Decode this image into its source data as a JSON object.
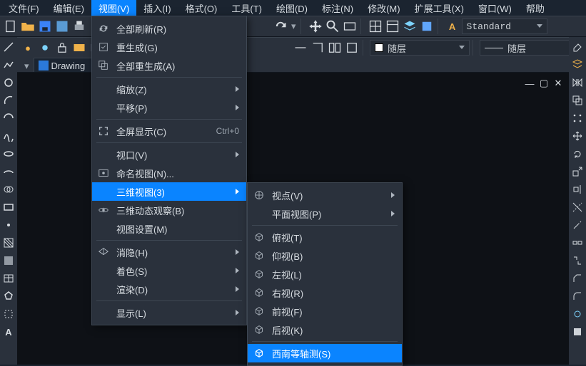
{
  "menubar": [
    "文件(F)",
    "编辑(E)",
    "视图(V)",
    "插入(I)",
    "格式(O)",
    "工具(T)",
    "绘图(D)",
    "标注(N)",
    "修改(M)",
    "扩展工具(X)",
    "窗口(W)",
    "帮助"
  ],
  "menubar_active_index": 2,
  "text_style_combo": "Standard",
  "layer_combo1": "随层",
  "layer_combo2": "随层",
  "drawing_tab": "Drawing",
  "menu_view": [
    {
      "type": "item",
      "icon": "refresh",
      "label": "全部刷新(R)"
    },
    {
      "type": "item",
      "icon": "regen",
      "label": "重生成(G)"
    },
    {
      "type": "item",
      "icon": "regenall",
      "label": "全部重生成(A)"
    },
    {
      "type": "sep"
    },
    {
      "type": "sub",
      "label": "缩放(Z)"
    },
    {
      "type": "sub",
      "label": "平移(P)"
    },
    {
      "type": "sep"
    },
    {
      "type": "item",
      "icon": "fullscreen",
      "label": "全屏显示(C)",
      "shortcut": "Ctrl+0"
    },
    {
      "type": "sep"
    },
    {
      "type": "sub",
      "label": "视口(V)"
    },
    {
      "type": "item",
      "icon": "namedview",
      "label": "命名视图(N)..."
    },
    {
      "type": "sub",
      "label": "三维视图(3)",
      "hl": true
    },
    {
      "type": "item",
      "icon": "orbit",
      "label": "三维动态观察(B)"
    },
    {
      "type": "item",
      "label": "视图设置(M)"
    },
    {
      "type": "sep"
    },
    {
      "type": "sub",
      "icon": "hide",
      "label": "消隐(H)"
    },
    {
      "type": "sub",
      "label": "着色(S)"
    },
    {
      "type": "sub",
      "label": "渲染(D)"
    },
    {
      "type": "sep"
    },
    {
      "type": "sub",
      "label": "显示(L)"
    }
  ],
  "submenu_3d": [
    {
      "type": "sub",
      "icon": "viewpoint",
      "label": "视点(V)"
    },
    {
      "type": "sub",
      "label": "平面视图(P)"
    },
    {
      "type": "sep"
    },
    {
      "type": "item",
      "icon": "cube",
      "label": "俯视(T)"
    },
    {
      "type": "item",
      "icon": "cube",
      "label": "仰视(B)"
    },
    {
      "type": "item",
      "icon": "cube",
      "label": "左视(L)"
    },
    {
      "type": "item",
      "icon": "cube",
      "label": "右视(R)"
    },
    {
      "type": "item",
      "icon": "cube",
      "label": "前视(F)"
    },
    {
      "type": "item",
      "icon": "cube",
      "label": "后视(K)"
    },
    {
      "type": "sep"
    },
    {
      "type": "item",
      "icon": "iso",
      "label": "西南等轴测(S)",
      "hl": true
    }
  ]
}
